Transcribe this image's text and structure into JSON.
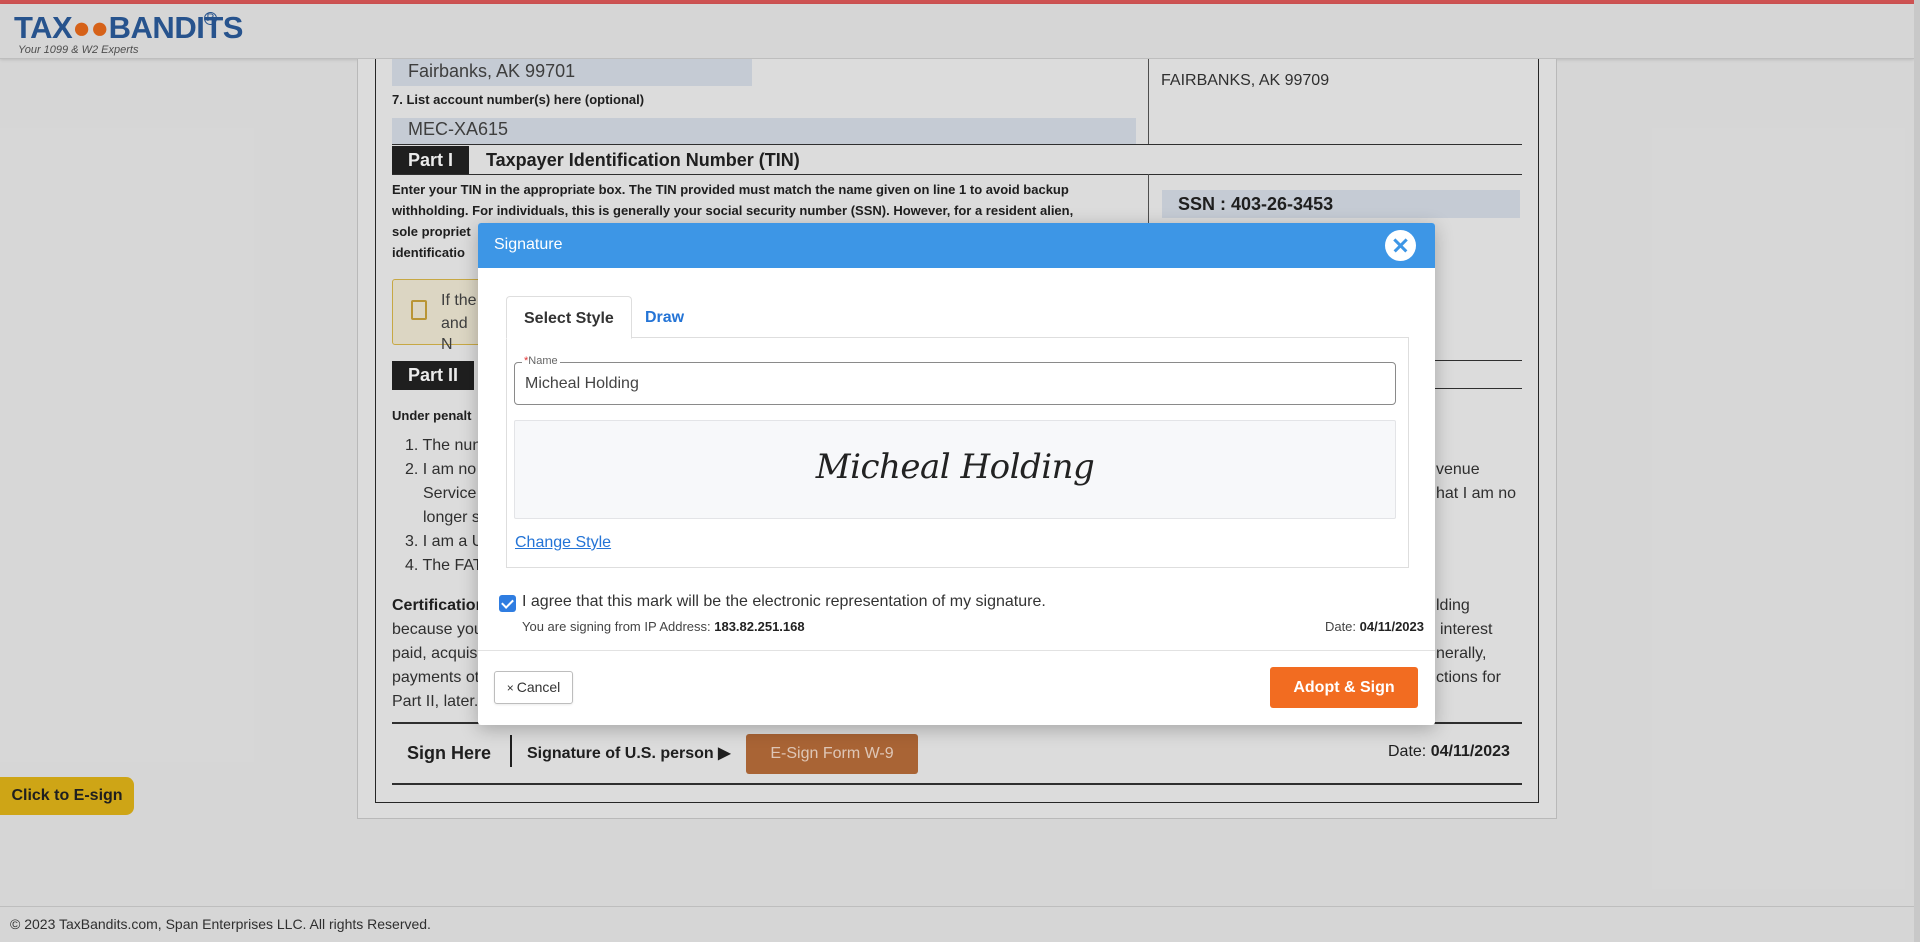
{
  "header": {
    "logo_text_tax": "TAX",
    "logo_text_bandits": "BANDITS",
    "logo_reg": "R",
    "tagline": "Your 1099 & W2 Experts"
  },
  "form": {
    "city_state_zip": "Fairbanks, AK 99701",
    "requester_address": "FAIRBANKS, AK 99709",
    "account_label": "7. List account number(s) here (optional)",
    "account_value": "MEC-XA615",
    "part1_tag": "Part I",
    "part1_title": "Taxpayer Identification Number (TIN)",
    "part1_line1": "Enter your TIN in the appropriate box. The TIN provided must match the name given on line 1 to avoid backup",
    "part1_line2": "withholding. For individuals, this is generally your social security number (SSN). However, for a resident alien,",
    "part1_line3": "sole propriet",
    "part1_line4": "identificatio",
    "ssn": "SSN : 403-26-3453",
    "notice_line1": "If the",
    "notice_line2": "and N",
    "part2_tag": "Part II",
    "under_penalties": "Under penalt",
    "list_1": "1. The nun",
    "list_2a": "2. I am no",
    "list_2b": "Service",
    "list_2c": "longer s",
    "list_2_right_a": "venue",
    "list_2_right_b": "hat I am no",
    "list_3": "3. I am a U",
    "list_4": "4. The FAT",
    "cert_label": "Certification",
    "cert_line2": "because you",
    "cert_line3": "paid, acquis",
    "cert_line4": "payments ot",
    "cert_line5": "Part II, later.",
    "cert_right1": "lding",
    "cert_right2": "interest",
    "cert_right3": "nerally,",
    "cert_right4": "ctions for",
    "sign_here": "Sign Here",
    "signature_of": "Signature of U.S. person",
    "esign_button": "E-Sign Form W-9",
    "date_label": "Date:",
    "date_value": "04/11/2023"
  },
  "esign_float": "Click to E-sign",
  "footer": "© 2023 TaxBandits.com, Span Enterprises LLC. All rights Reserved.",
  "modal": {
    "title": "Signature",
    "tabs": [
      "Select Style",
      "Draw"
    ],
    "name_label_req": "*",
    "name_label": "Name",
    "name_value": "Micheal Holding",
    "signature_preview": "Micheal Holding",
    "change_style": "Change Style",
    "agree_checked": true,
    "agree_text": "I agree that this mark will be the electronic representation of my signature.",
    "ip_label": "You are signing from IP Address: ",
    "ip_value": "183.82.251.168",
    "date_label": "Date: ",
    "date_value": "04/11/2023",
    "cancel_x": "×",
    "cancel_label": "Cancel",
    "adopt_label": "Adopt & Sign"
  },
  "colors": {
    "header_blue": "#3d96e6",
    "adopt_orange": "#f26c21",
    "link_blue": "#2474d6",
    "esign_yellow": "#e0b318"
  }
}
